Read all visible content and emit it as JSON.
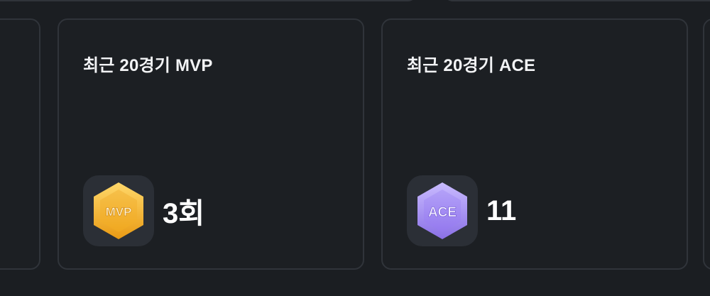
{
  "cards": [
    {
      "title": "최근 20경기 MVP",
      "badge_label": "MVP",
      "badge_icon": "mvp-badge-icon",
      "badge_color": "#f2b233",
      "value": "3회"
    },
    {
      "title": "최근 20경기 ACE",
      "badge_label": "ACE",
      "badge_icon": "ace-badge-icon",
      "badge_color": "#9b86f0",
      "value": "11"
    }
  ]
}
